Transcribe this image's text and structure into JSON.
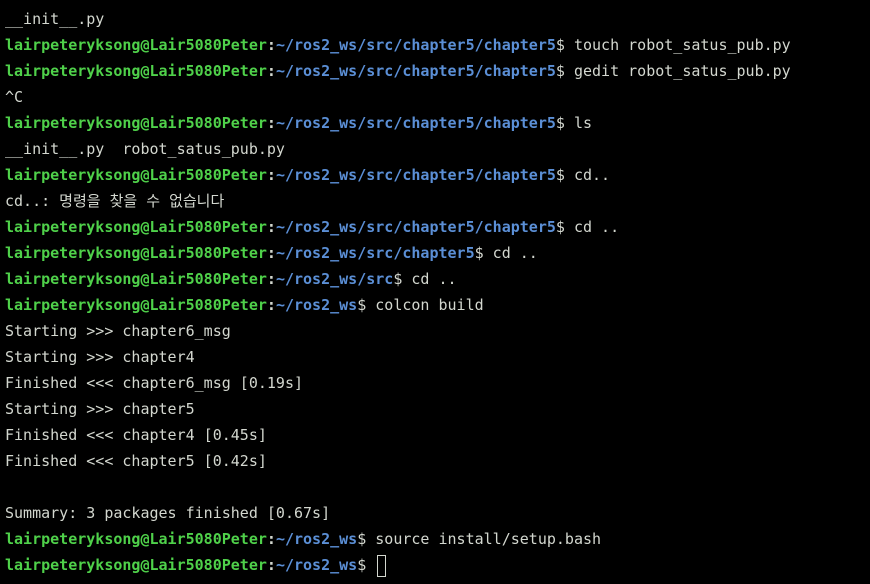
{
  "colors": {
    "background": "#000000",
    "user_host": "#4fd14a",
    "path": "#5b8fd6",
    "text": "#d3d7cf"
  },
  "prompt": {
    "user_host": "lairpeteryksong@Lair5080Peter",
    "separator": ":",
    "dollar": "$"
  },
  "lines": [
    {
      "type": "output",
      "text": "__init__.py"
    },
    {
      "type": "prompt",
      "path": "~/ros2_ws/src/chapter5/chapter5",
      "cmd": " touch robot_satus_pub.py"
    },
    {
      "type": "prompt",
      "path": "~/ros2_ws/src/chapter5/chapter5",
      "cmd": " gedit robot_satus_pub.py"
    },
    {
      "type": "output",
      "text": "^C"
    },
    {
      "type": "prompt",
      "path": "~/ros2_ws/src/chapter5/chapter5",
      "cmd": " ls"
    },
    {
      "type": "output",
      "text": "__init__.py  robot_satus_pub.py"
    },
    {
      "type": "prompt",
      "path": "~/ros2_ws/src/chapter5/chapter5",
      "cmd": " cd.."
    },
    {
      "type": "output",
      "text": "cd..: 명령을 찾을 수 없습니다"
    },
    {
      "type": "prompt",
      "path": "~/ros2_ws/src/chapter5/chapter5",
      "cmd": " cd .."
    },
    {
      "type": "prompt",
      "path": "~/ros2_ws/src/chapter5",
      "cmd": " cd .."
    },
    {
      "type": "prompt",
      "path": "~/ros2_ws/src",
      "cmd": " cd .."
    },
    {
      "type": "prompt",
      "path": "~/ros2_ws",
      "cmd": " colcon build"
    },
    {
      "type": "output",
      "text": "Starting >>> chapter6_msg"
    },
    {
      "type": "output",
      "text": "Starting >>> chapter4"
    },
    {
      "type": "output",
      "text": "Finished <<< chapter6_msg [0.19s]"
    },
    {
      "type": "output",
      "text": "Starting >>> chapter5"
    },
    {
      "type": "output",
      "text": "Finished <<< chapter4 [0.45s]"
    },
    {
      "type": "output",
      "text": "Finished <<< chapter5 [0.42s]"
    },
    {
      "type": "output",
      "text": ""
    },
    {
      "type": "output",
      "text": "Summary: 3 packages finished [0.67s]"
    },
    {
      "type": "prompt",
      "path": "~/ros2_ws",
      "cmd": " source install/setup.bash"
    },
    {
      "type": "prompt",
      "path": "~/ros2_ws",
      "cmd": " ",
      "cursor": true
    }
  ]
}
